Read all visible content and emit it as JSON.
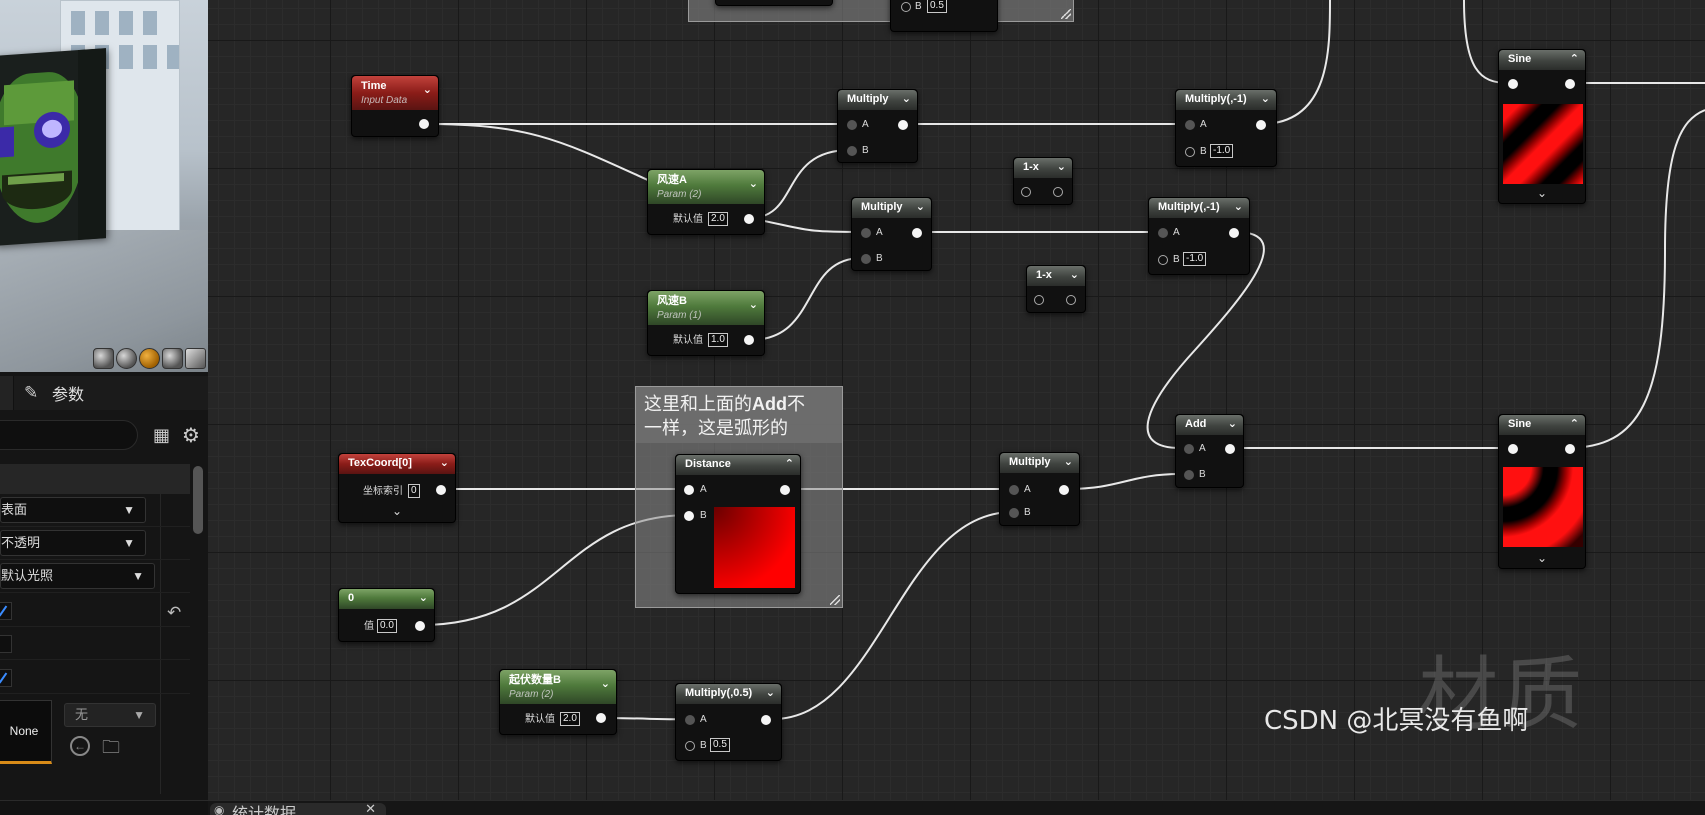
{
  "left_panel": {
    "params_tab_label": "参数",
    "props": {
      "blend_domain": "表面",
      "blend_mode": "不透明",
      "shading_model": "默认光照"
    },
    "texture": {
      "slot_label": "None",
      "combo_value": "无"
    }
  },
  "graph": {
    "comment": {
      "text_line1_pre": "这里和上面的",
      "text_line1_bold": "Add",
      "text_line1_post": "不",
      "text_line2": "一样，这是弧形的"
    },
    "nodes": {
      "top_mult": {
        "pin_b": "B",
        "b_val": "0.5"
      },
      "time": {
        "title": "Time",
        "sub": "Input Data"
      },
      "mult1": {
        "title": "Multiply",
        "a": "A",
        "b": "B"
      },
      "mult_neg1_top": {
        "title": "Multiply(,-1)",
        "a": "A",
        "b": "B",
        "b_val": "-1.0"
      },
      "sine_top": {
        "title": "Sine"
      },
      "speed_a": {
        "title": "风速A",
        "sub": "Param (2)",
        "label": "默认值",
        "val": "2.0"
      },
      "one_minus_x1": {
        "title": "1-x"
      },
      "mult2": {
        "title": "Multiply",
        "a": "A",
        "b": "B"
      },
      "mult_neg1_mid": {
        "title": "Multiply(,-1)",
        "a": "A",
        "b": "B",
        "b_val": "-1.0"
      },
      "one_minus_x2": {
        "title": "1-x"
      },
      "speed_b": {
        "title": "风速B",
        "sub": "Param (1)",
        "label": "默认值",
        "val": "1.0"
      },
      "texcoord": {
        "title": "TexCoord[0]",
        "label": "坐标索引",
        "val": "0"
      },
      "distance": {
        "title": "Distance",
        "a": "A",
        "b": "B"
      },
      "mult3": {
        "title": "Multiply",
        "a": "A",
        "b": "B"
      },
      "add": {
        "title": "Add",
        "a": "A",
        "b": "B"
      },
      "sine_bottom": {
        "title": "Sine"
      },
      "const0": {
        "title": "0",
        "label": "值",
        "val": "0.0"
      },
      "wave_count_b": {
        "title": "起伏数量B",
        "sub": "Param (2)",
        "label": "默认值",
        "val": "2.0"
      },
      "mult_half": {
        "title": "Multiply(,0.5)",
        "a": "A",
        "b": "B",
        "b_val": "0.5"
      }
    }
  },
  "watermark": {
    "big": "材质",
    "csdn": "CSDN @北冥没有鱼啊"
  },
  "bottom_tab": {
    "label": "统计数据"
  },
  "colors": {
    "param_header": "#4f7a3c",
    "input_header": "#8a1c18",
    "math_header": "#3f433f",
    "accent_orange": "#d88b18",
    "check_blue": "#3a8cff"
  }
}
